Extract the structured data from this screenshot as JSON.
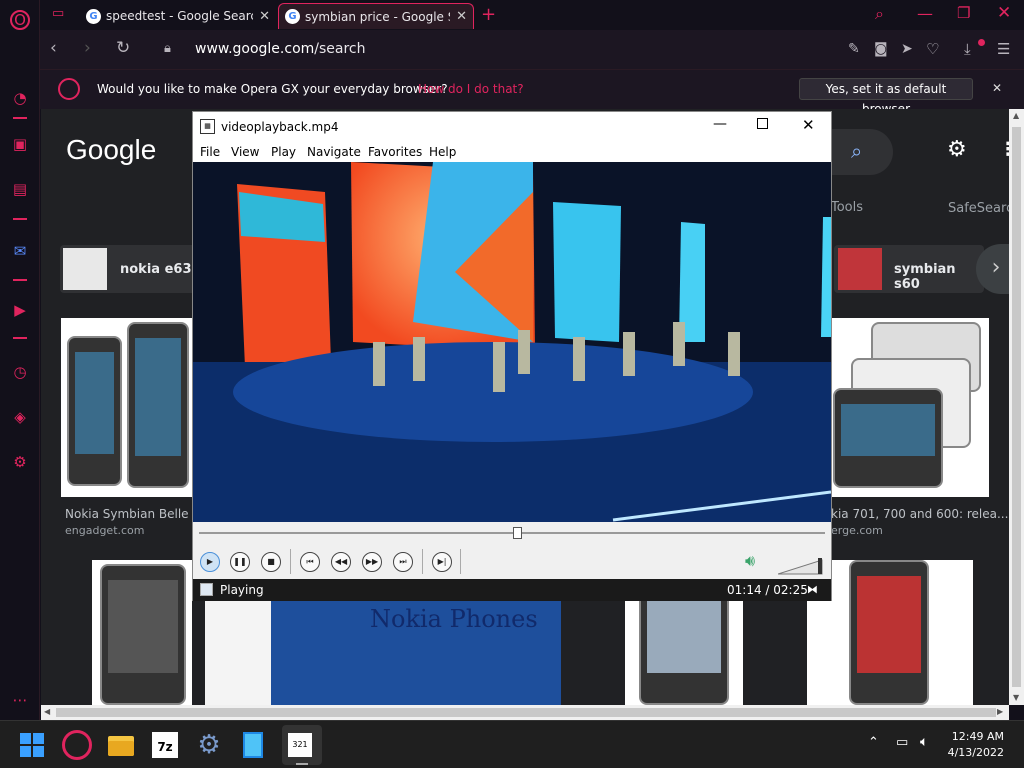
{
  "browser": {
    "tabs": [
      {
        "title": "speedtest - Google Search",
        "active": false
      },
      {
        "title": "symbian price - Google Sea",
        "active": true
      }
    ],
    "url_domain": "www.google.com",
    "url_path": "/search",
    "notification": {
      "question": "Would you like to make Opera GX your everyday browser?",
      "how_link": "How do I do that?",
      "yes_button": "Yes, set it as default browser"
    },
    "accent": "#e0245e"
  },
  "google": {
    "logo": "Google",
    "tools": "Tools",
    "safesearch": "SafeSearch",
    "chips": [
      {
        "label": "nokia e63"
      },
      {
        "label": "symbian s60"
      }
    ],
    "results": [
      {
        "caption": "Nokia Symbian Belle Re",
        "source": "engadget.com"
      },
      {
        "caption": "kia 701, 700 and 600: relea...",
        "source": "erge.com"
      }
    ],
    "banner_text": "Nokia Phones"
  },
  "player": {
    "title": "videoplayback.mp4",
    "menu": [
      "File",
      "View",
      "Play",
      "Navigate",
      "Favorites",
      "Help"
    ],
    "status": "Playing",
    "time": "01:14 / 02:25",
    "progress": 0.51
  },
  "taskbar": {
    "time": "12:49 AM",
    "date": "4/13/2022"
  }
}
